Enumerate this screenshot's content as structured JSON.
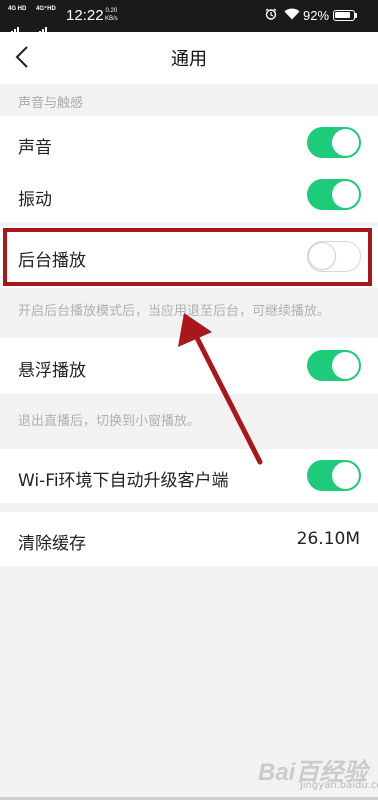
{
  "status_bar": {
    "signal_1": "4G HD",
    "signal_2": "4G⁺HD",
    "time": "12:22",
    "speed_value": "0.20",
    "speed_unit": "KB/s",
    "battery": "92%",
    "icons": [
      "alarm-icon",
      "wifi-icon",
      "battery-icon"
    ]
  },
  "nav": {
    "back_icon": "chevron-left-icon",
    "title": "通用"
  },
  "sections": {
    "sound_touch": "声音与触感"
  },
  "settings": {
    "sound": {
      "label": "声音",
      "enabled": true
    },
    "vibrate": {
      "label": "振动",
      "enabled": true
    },
    "background_play": {
      "label": "后台播放",
      "enabled": false,
      "hint": "开启后台播放模式后，当应用退至后台，可继续播放。"
    },
    "float_play": {
      "label": "悬浮播放",
      "enabled": true,
      "hint": "退出直播后，切换到小窗播放。"
    },
    "wifi_upgrade": {
      "label": "Wi-Fi环境下自动升级客户端",
      "enabled": true
    },
    "clear_cache": {
      "label": "清除缓存",
      "value": "26.10M"
    }
  },
  "annotation": {
    "color": "#a8171c"
  },
  "watermark": {
    "text": "Bai百经验",
    "sub": "jingyan.baidu.com"
  },
  "colors": {
    "toggle_on": "#1ecb7b",
    "background": "#f2f2f2"
  }
}
